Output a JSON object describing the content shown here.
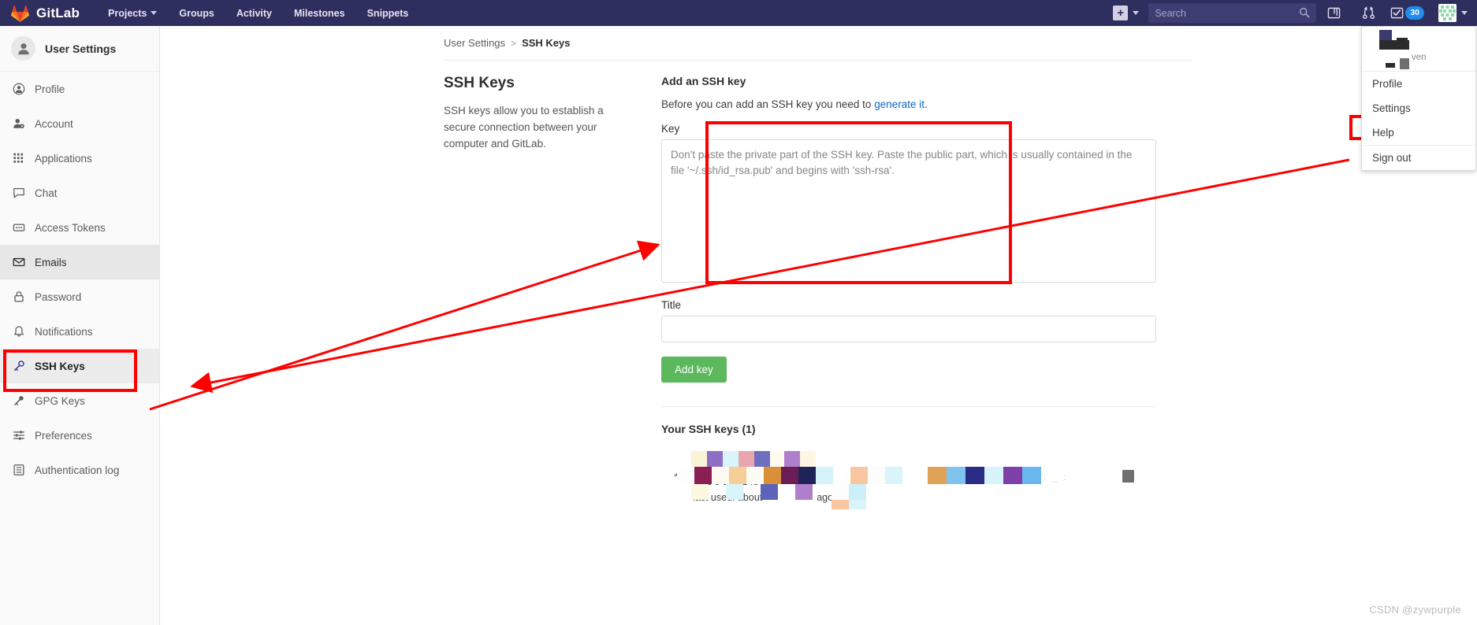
{
  "navbar": {
    "brand": "GitLab",
    "brand_icon": "gitlab-tanuki-logo",
    "links": [
      {
        "label": "Projects",
        "has_caret": true,
        "icon": "chevron-down-icon"
      },
      {
        "label": "Groups",
        "has_caret": false
      },
      {
        "label": "Activity",
        "has_caret": false
      },
      {
        "label": "Milestones",
        "has_caret": false
      },
      {
        "label": "Snippets",
        "has_caret": false
      }
    ],
    "new_button": {
      "glyph": "+",
      "icon": "plus-square-icon",
      "caret_icon": "chevron-down-icon"
    },
    "search": {
      "placeholder": "Search",
      "value": "",
      "icon": "search-icon"
    },
    "icons": [
      {
        "name": "issue-boards-icon",
        "title": "Issue Boards"
      },
      {
        "name": "merge-requests-icon",
        "title": "Merge Requests"
      },
      {
        "name": "todos-icon",
        "title": "Todos"
      }
    ],
    "todos_count": "30",
    "avatar": {
      "icon": "user-avatar",
      "caret_icon": "chevron-down-icon"
    },
    "bg_color": "#2e2e5f",
    "badge_color": "#1f8ceb"
  },
  "user_dropdown": {
    "header": {
      "name_redacted": "",
      "handle_redacted": "ven"
    },
    "items": [
      {
        "label": "Profile",
        "highlighted": false
      },
      {
        "label": "Settings",
        "highlighted": true
      },
      {
        "label": "Help",
        "highlighted": false
      },
      {
        "label": "Sign out",
        "highlighted": false
      }
    ]
  },
  "sidebar": {
    "header": {
      "title": "User Settings",
      "icon": "user-avatar-icon"
    },
    "items": [
      {
        "label": "Profile",
        "icon": "user-circle-icon",
        "state": ""
      },
      {
        "label": "Account",
        "icon": "user-gear-icon",
        "state": ""
      },
      {
        "label": "Applications",
        "icon": "apps-grid-icon",
        "state": ""
      },
      {
        "label": "Chat",
        "icon": "chat-bubble-icon",
        "state": ""
      },
      {
        "label": "Access Tokens",
        "icon": "token-icon",
        "state": ""
      },
      {
        "label": "Emails",
        "icon": "envelope-icon",
        "state": "hovered"
      },
      {
        "label": "Password",
        "icon": "lock-icon",
        "state": ""
      },
      {
        "label": "Notifications",
        "icon": "bell-icon",
        "state": ""
      },
      {
        "label": "SSH Keys",
        "icon": "key-icon",
        "state": "active"
      },
      {
        "label": "GPG Keys",
        "icon": "key-icon",
        "state": ""
      },
      {
        "label": "Preferences",
        "icon": "sliders-icon",
        "state": ""
      },
      {
        "label": "Authentication log",
        "icon": "log-list-icon",
        "state": ""
      }
    ]
  },
  "breadcrumb": {
    "parent": "User Settings",
    "separator": ">",
    "current": "SSH Keys"
  },
  "main": {
    "left": {
      "heading": "SSH Keys",
      "description": "SSH keys allow you to establish a secure connection between your computer and GitLab."
    },
    "right": {
      "title": "Add an SSH key",
      "subtitle_before": "Before you can add an SSH key you need to ",
      "subtitle_link": "generate it",
      "subtitle_after": ".",
      "key_label": "Key",
      "key_placeholder": "Don't paste the private part of the SSH key. Paste the public part, which is usually contained in the file '~/.ssh/id_rsa.pub' and begins with 'ssh-rsa'.",
      "key_value": "",
      "title_label": "Title",
      "title_placeholder": "",
      "title_value": "",
      "add_key_button": "Add key",
      "add_key_color": "#5cb85c"
    },
    "keys_list": {
      "heading": "Your SSH keys (1)",
      "row": {
        "key_icon": "key-icon",
        "name_visible_fragment": "215.net",
        "fingerprint_visible_fragment": "0 13 5 1 262  f3 01",
        "last_used_label": "last used: about",
        "last_used_suffix": "ago",
        "date_redacted": "",
        "delete_icon": "trash-icon"
      }
    }
  },
  "annotations": {
    "highlight_color": "#fe0000",
    "boxes": [
      {
        "name": "sidebar-ssh-keys-highlight"
      },
      {
        "name": "key-textarea-highlight"
      },
      {
        "name": "dropdown-settings-highlight"
      }
    ],
    "arrows": [
      {
        "name": "arrow-to-key-field",
        "direction": "right"
      },
      {
        "name": "arrow-to-ssh-keys",
        "direction": "left"
      }
    ]
  },
  "watermark": "CSDN @zywpurple"
}
